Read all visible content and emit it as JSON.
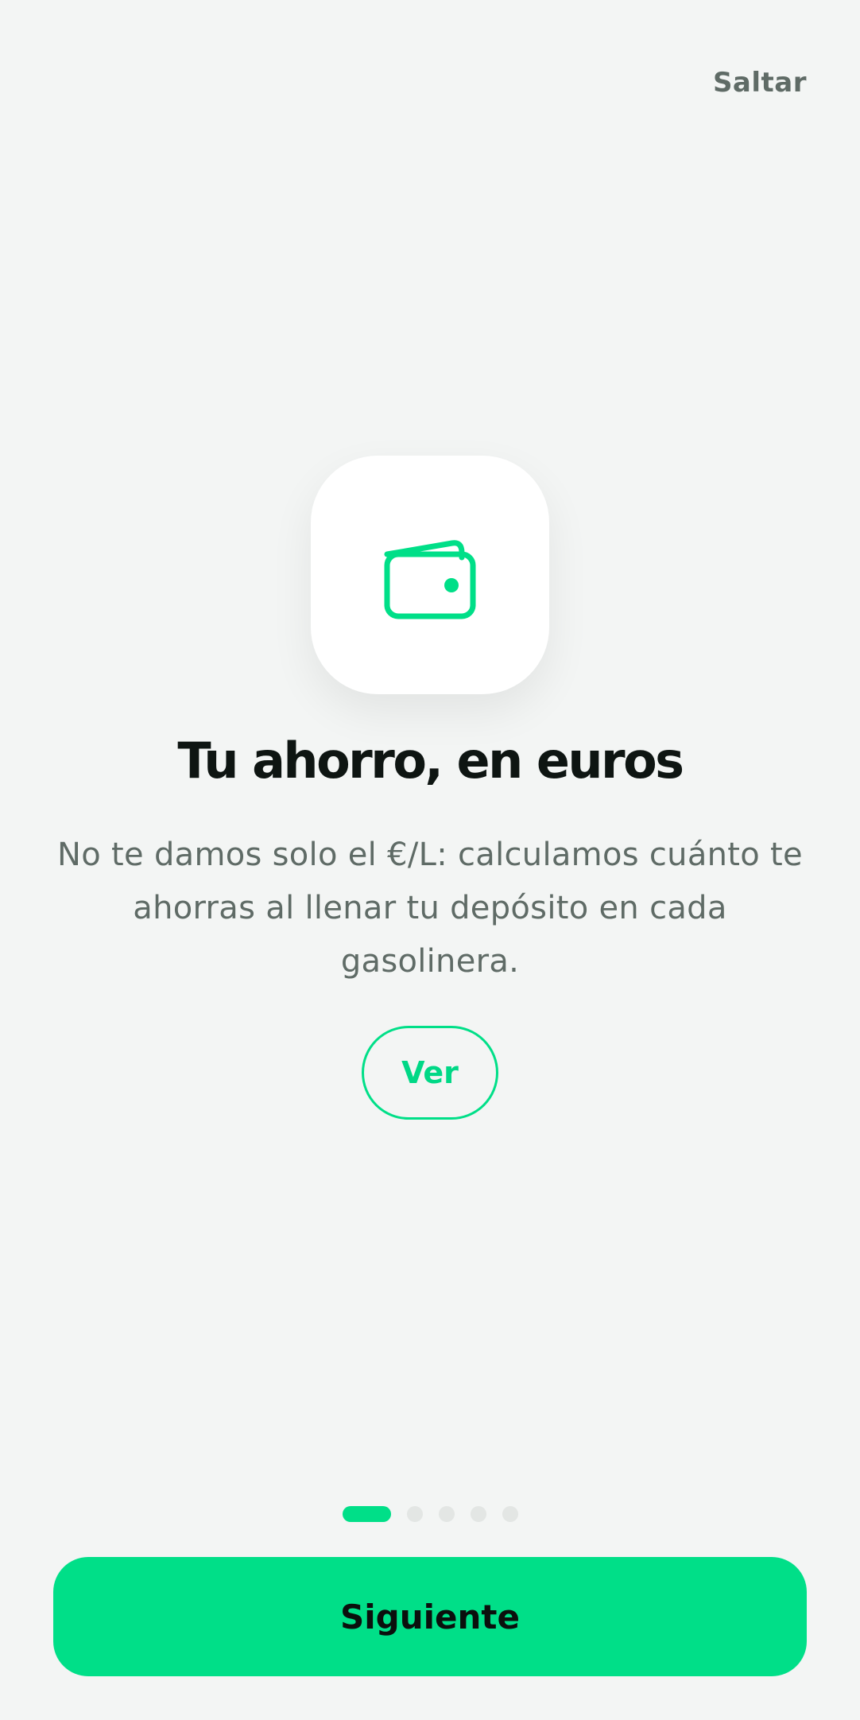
{
  "header": {
    "skip_label": "Saltar"
  },
  "slide": {
    "icon": "wallet-icon",
    "title": "Tu ahorro, en euros",
    "description": "No te damos solo el €/L: calculamos cuánto te ahorras al llenar tu depósito en cada gasolinera.",
    "action_label": "Ver"
  },
  "pagination": {
    "total": 5,
    "current": 1
  },
  "footer": {
    "next_label": "Siguiente"
  },
  "colors": {
    "accent": "#00df88",
    "background": "#f3f5f4",
    "title": "#0e1512",
    "body_text": "#5f6b66"
  }
}
